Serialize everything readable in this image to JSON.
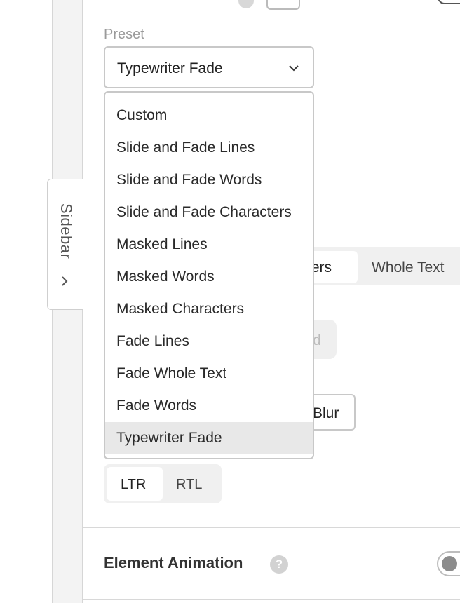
{
  "sidebar_tab": {
    "label": "Sidebar",
    "icon": "chevron-right-icon"
  },
  "preset": {
    "label": "Preset",
    "selected": "Typewriter Fade",
    "options": [
      "Custom",
      "Slide and Fade Lines",
      "Slide and Fade Words",
      "Slide and Fade Characters",
      "Masked Lines",
      "Masked Words",
      "Masked Characters",
      "Fade Lines",
      "Fade Whole Text",
      "Fade Words",
      "Typewriter Fade"
    ],
    "selected_index": 10
  },
  "split_by": {
    "visible_active_fragment": "ters",
    "whole_text": "Whole Text"
  },
  "partially_hidden": {
    "fragment_d": "d",
    "fragment_blur": "Blur"
  },
  "direction": {
    "ltr": "LTR",
    "rtl": "RTL",
    "selected": "LTR"
  },
  "element_animation": {
    "title": "Element Animation",
    "help": "?",
    "enabled": false
  },
  "colors": {
    "selected_bg": "#e8e8e8",
    "border": "#c8c8c8",
    "label_gray": "#9a9a9a"
  }
}
